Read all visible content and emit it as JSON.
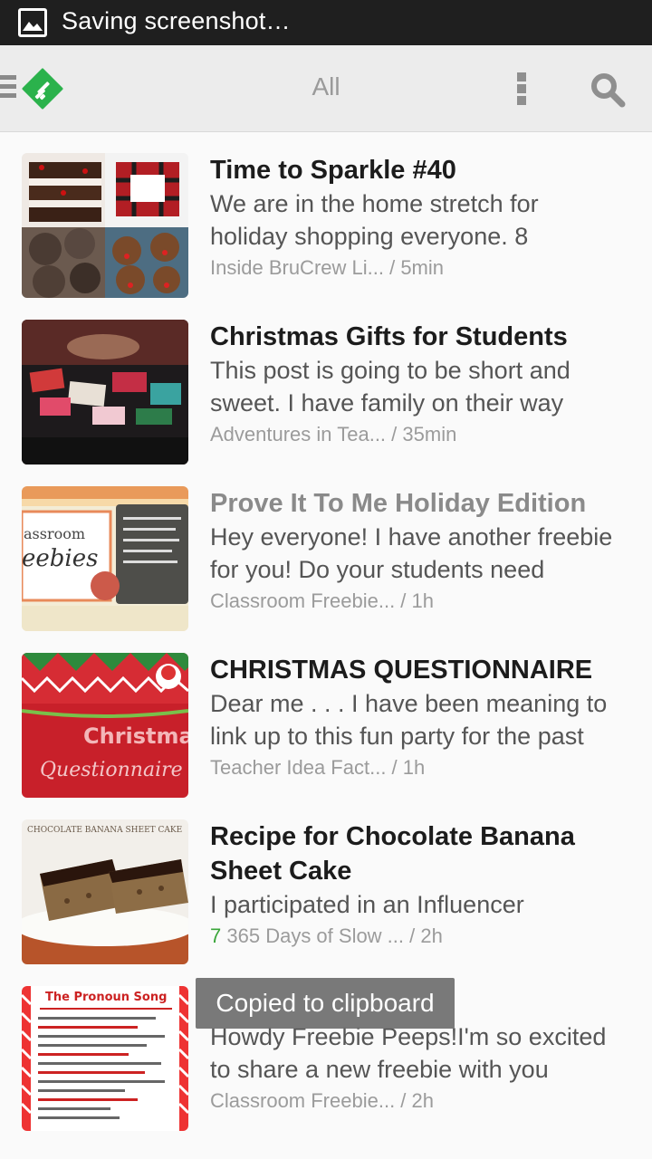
{
  "status_bar": {
    "text": "Saving screenshot…",
    "icon": "image-icon"
  },
  "app_bar": {
    "title": "All",
    "icons": [
      "menu-icon",
      "feedly-logo",
      "more-vert-icon",
      "search-icon"
    ],
    "brand_color": "#2bb24c"
  },
  "articles": [
    {
      "title": "Time to Sparkle #40",
      "snippet_1": "We are in the home stretch for",
      "snippet_2": "holiday shopping everyone.  8",
      "count": "",
      "source": "Inside BruCrew Li...",
      "sep": " / ",
      "age": "5min",
      "read": false
    },
    {
      "title": "Christmas Gifts for Students",
      "snippet_1": "This post is going to be short and",
      "snippet_2": "sweet. I have family on their way",
      "count": "",
      "source": "Adventures in Tea...",
      "sep": " / ",
      "age": "35min",
      "read": false
    },
    {
      "title": "Prove It To Me Holiday Edition",
      "snippet_1": "Hey everyone!  I have another freebie",
      "snippet_2": "for you! Do your students need",
      "count": "",
      "source": "Classroom Freebie...",
      "sep": " / ",
      "age": "1h",
      "read": true
    },
    {
      "title": "CHRISTMAS QUESTIONNAIRE",
      "snippet_1": "Dear me . . . I have been meaning to",
      "snippet_2": "link up to this fun party for the past",
      "count": "",
      "source": "Teacher Idea Fact...",
      "sep": " / ",
      "age": "1h",
      "read": false
    },
    {
      "title": "Recipe for Chocolate Banana",
      "title_2": "Sheet Cake",
      "snippet_1": "I participated in an Influencer",
      "snippet_2": "",
      "count": "7",
      "source": "365 Days of Slow ...",
      "sep": " / ",
      "age": "2h",
      "read": false
    },
    {
      "title": "",
      "snippet_1": "Howdy Freebie Peeps!I'm so excited",
      "snippet_2": "to share a new freebie with you",
      "count": "",
      "source": "Classroom Freebie...",
      "sep": " / ",
      "age": "2h",
      "read": false
    }
  ],
  "thumb_labels": {
    "t3_a": "assroom",
    "t3_b": "eebies",
    "t3_c": "Christmas",
    "t3_d": "Questionnaire",
    "t5_a": "CHOCOLATE BANANA SHEET CAKE",
    "t6_a": "The Pronoun Song"
  },
  "toast": {
    "text": "Copied to clipboard"
  }
}
